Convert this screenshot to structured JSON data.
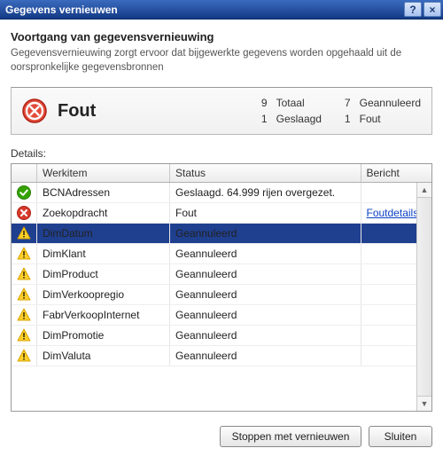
{
  "window": {
    "title": "Gegevens vernieuwen",
    "help_glyph": "?",
    "close_glyph": "×"
  },
  "header": {
    "heading": "Voortgang van gegevensvernieuwing",
    "description": "Gegevensvernieuwing zorgt ervoor dat bijgewerkte gegevens worden opgehaald uit de oorspronkelijke gegevensbronnen"
  },
  "summary": {
    "label": "Fout",
    "totals": {
      "total_n": "9",
      "total_label": "Totaal",
      "cancelled_n": "7",
      "cancelled_label": "Geannuleerd",
      "success_n": "1",
      "success_label": "Geslaagd",
      "error_n": "1",
      "error_label": "Fout"
    }
  },
  "details_label": "Details:",
  "columns": {
    "work_item": "Werkitem",
    "status": "Status",
    "message": "Bericht"
  },
  "rows": [
    {
      "icon": "success",
      "work": "BCNAdressen",
      "status": "Geslaagd. 64.999 rijen overgezet.",
      "msg": "",
      "link": false,
      "selected": false
    },
    {
      "icon": "error",
      "work": "Zoekopdracht",
      "status": "Fout",
      "msg": "Foutdetails",
      "link": true,
      "selected": false
    },
    {
      "icon": "warning",
      "work": "DimDatum",
      "status": "Geannuleerd",
      "msg": "",
      "link": false,
      "selected": true
    },
    {
      "icon": "warning",
      "work": "DimKlant",
      "status": "Geannuleerd",
      "msg": "",
      "link": false,
      "selected": false
    },
    {
      "icon": "warning",
      "work": "DimProduct",
      "status": "Geannuleerd",
      "msg": "",
      "link": false,
      "selected": false
    },
    {
      "icon": "warning",
      "work": "DimVerkoopregio",
      "status": "Geannuleerd",
      "msg": "",
      "link": false,
      "selected": false
    },
    {
      "icon": "warning",
      "work": "FabrVerkoopInternet",
      "status": "Geannuleerd",
      "msg": "",
      "link": false,
      "selected": false
    },
    {
      "icon": "warning",
      "work": "DimPromotie",
      "status": "Geannuleerd",
      "msg": "",
      "link": false,
      "selected": false
    },
    {
      "icon": "warning",
      "work": "DimValuta",
      "status": "Geannuleerd",
      "msg": "",
      "link": false,
      "selected": false
    }
  ],
  "buttons": {
    "stop": "Stoppen met vernieuwen",
    "close": "Sluiten"
  }
}
